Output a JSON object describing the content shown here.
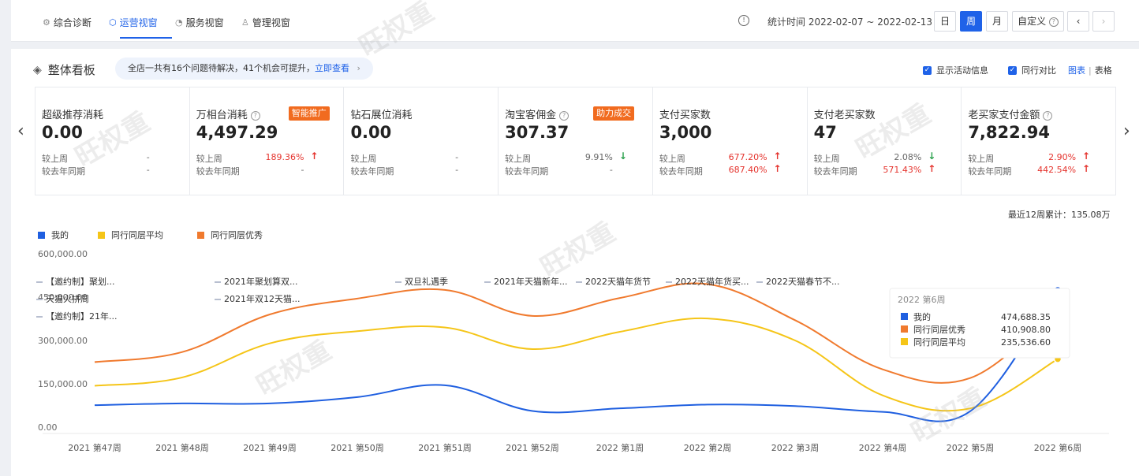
{
  "tabs": [
    {
      "label": "综合诊断",
      "icon": "diagnosis-icon",
      "glyph": "⚙"
    },
    {
      "label": "运营视窗",
      "icon": "operations-icon",
      "glyph": "⬡"
    },
    {
      "label": "服务视窗",
      "icon": "headset-icon",
      "glyph": "◔"
    },
    {
      "label": "管理视窗",
      "icon": "manage-icon",
      "glyph": "♙"
    }
  ],
  "active_tab": "运营视窗",
  "stat_time": "统计时间 2022-02-07 ~ 2022-02-13",
  "period_buttons": [
    {
      "label": "日"
    },
    {
      "label": "周"
    },
    {
      "label": "月"
    },
    {
      "label": "自定义"
    }
  ],
  "active_period": "周",
  "panel": {
    "title": "整体看板",
    "notice_text": "全店一共有16个问题待解决，41个机会可提升，",
    "notice_link": "立即查看",
    "show_activity": "显示活动信息",
    "peer_compare": "同行对比",
    "view_chart": "图表",
    "view_table": "表格"
  },
  "compare_labels": {
    "wow": "较上周",
    "yoy": "较去年同期"
  },
  "metrics": [
    {
      "name": "超级推荐消耗",
      "value": "0.00",
      "help": false,
      "tag": "",
      "wow": "-",
      "wow_dir": "none",
      "yoy": "-",
      "yoy_dir": "none"
    },
    {
      "name": "万相台消耗",
      "value": "4,497.29",
      "help": true,
      "tag": "智能推广",
      "wow": "189.36%",
      "wow_dir": "up",
      "yoy": "-",
      "yoy_dir": "none"
    },
    {
      "name": "钻石展位消耗",
      "value": "0.00",
      "help": false,
      "tag": "",
      "wow": "-",
      "wow_dir": "none",
      "yoy": "-",
      "yoy_dir": "none"
    },
    {
      "name": "淘宝客佣金",
      "value": "307.37",
      "help": true,
      "tag": "助力成交",
      "wow": "9.91%",
      "wow_dir": "down",
      "yoy": "-",
      "yoy_dir": "none"
    },
    {
      "name": "支付买家数",
      "value": "3,000",
      "help": false,
      "tag": "",
      "wow": "677.20%",
      "wow_dir": "up",
      "yoy": "687.40%",
      "yoy_dir": "up"
    },
    {
      "name": "支付老买家数",
      "value": "47",
      "help": false,
      "tag": "",
      "wow": "2.08%",
      "wow_dir": "down",
      "yoy": "571.43%",
      "yoy_dir": "up"
    },
    {
      "name": "老买家支付金额",
      "value": "7,822.94",
      "help": true,
      "tag": "",
      "wow": "2.90%",
      "wow_dir": "up",
      "yoy": "442.54%",
      "yoy_dir": "up"
    }
  ],
  "cumulative": "最近12周累计：135.08万",
  "chart_data": {
    "type": "line",
    "categories": [
      "2021 第47周",
      "2021 第48周",
      "2021 第49周",
      "2021 第50周",
      "2021 第51周",
      "2021 第52周",
      "2022 第1周",
      "2022 第2周",
      "2022 第3周",
      "2022 第4周",
      "2022 第5周",
      "2022 第6周"
    ],
    "series": [
      {
        "name": "我的",
        "color": "#1f5fe0",
        "values": [
          76000,
          82000,
          82000,
          104000,
          145000,
          56000,
          65000,
          78000,
          73000,
          53000,
          55000,
          474688.35
        ]
      },
      {
        "name": "同行同层平均",
        "color": "#f5c518",
        "values": [
          143000,
          172000,
          290000,
          332000,
          345000,
          270000,
          330000,
          376000,
          300000,
          110000,
          65000,
          235536.6
        ]
      },
      {
        "name": "同行同层优秀",
        "color": "#f07a2e",
        "values": [
          225000,
          260000,
          390000,
          445000,
          475000,
          385000,
          447000,
          495000,
          370000,
          200000,
          170000,
          410908.8
        ]
      }
    ],
    "yticks": [
      "600,000.00",
      "450,000.00",
      "300,000.00",
      "150,000.00",
      "0.00"
    ],
    "ylim": [
      0,
      600000
    ],
    "activities": [
      "【邀约制】聚划...",
      "2021年聚划算双...",
      "双旦礼遇季",
      "2021年天猫新年...",
      "2022天猫年货节",
      "2022天猫年货买...",
      "2022天猫春节不...",
      "天猫火拼周",
      "2021年双12天猫...",
      "【邀约制】21年..."
    ],
    "tooltip": {
      "title": "2022 第6周",
      "rows": [
        {
          "name": "我的",
          "value": "474,688.35",
          "color": "#1f5fe0"
        },
        {
          "name": "同行同层优秀",
          "value": "410,908.80",
          "color": "#f07a2e"
        },
        {
          "name": "同行同层平均",
          "value": "235,536.60",
          "color": "#f5c518"
        }
      ]
    }
  },
  "watermark": "旺权重"
}
